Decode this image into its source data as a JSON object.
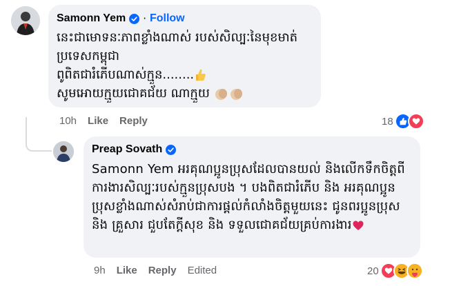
{
  "comment": {
    "author": "Samonn Yem",
    "follow_label": "Follow",
    "separator": "·",
    "lines": [
      "នេះជាមោទនៈភាពខ្លាំងណាស់ របស់សិល្បៈនៃមុខមាត់",
      "ប្រទេសកម្ពុជា",
      "ពូពិតជារំភើបណាស់ក្មួន........",
      "សូមអោយក្មួយជោគជ័យ ណាក្មួយ"
    ],
    "time": "10h",
    "like_label": "Like",
    "reply_label": "Reply",
    "reaction_count": "18",
    "reaction_icons": [
      "like-reaction-icon",
      "love-reaction-icon"
    ]
  },
  "reply": {
    "author": "Preap Sovath",
    "text": "Samonn Yem អរគុណប្អូនប្រុសដែលបានយល់ និងលើកទឹកចិត្តពីការងារសិល្បៈរបស់ក្មួនប្រុសបង ។ បងពិតជារំភើប និង អរគុណប្អូនប្រុសខ្លាំងណាស់សំរាប់ជាការផ្តល់កំលាំងចិត្តមួយនេះ ជូនពរប្អូនប្រុស និង គ្រួសារ ជួបតែក្តីសុខ និង ទទួលជោគជ័យគ្រប់ការងារ",
    "time": "9h",
    "like_label": "Like",
    "reply_label": "Reply",
    "edited_label": "Edited",
    "reaction_count": "20",
    "reaction_icons": [
      "love-reaction-icon",
      "haha-reaction-icon",
      "care-reaction-icon"
    ]
  },
  "colors": {
    "bubble": "#f0f2f5",
    "link": "#0866ff",
    "muted": "#65676b",
    "like": "#0866ff",
    "love": "#f33e58",
    "haha": "#f7b125"
  }
}
